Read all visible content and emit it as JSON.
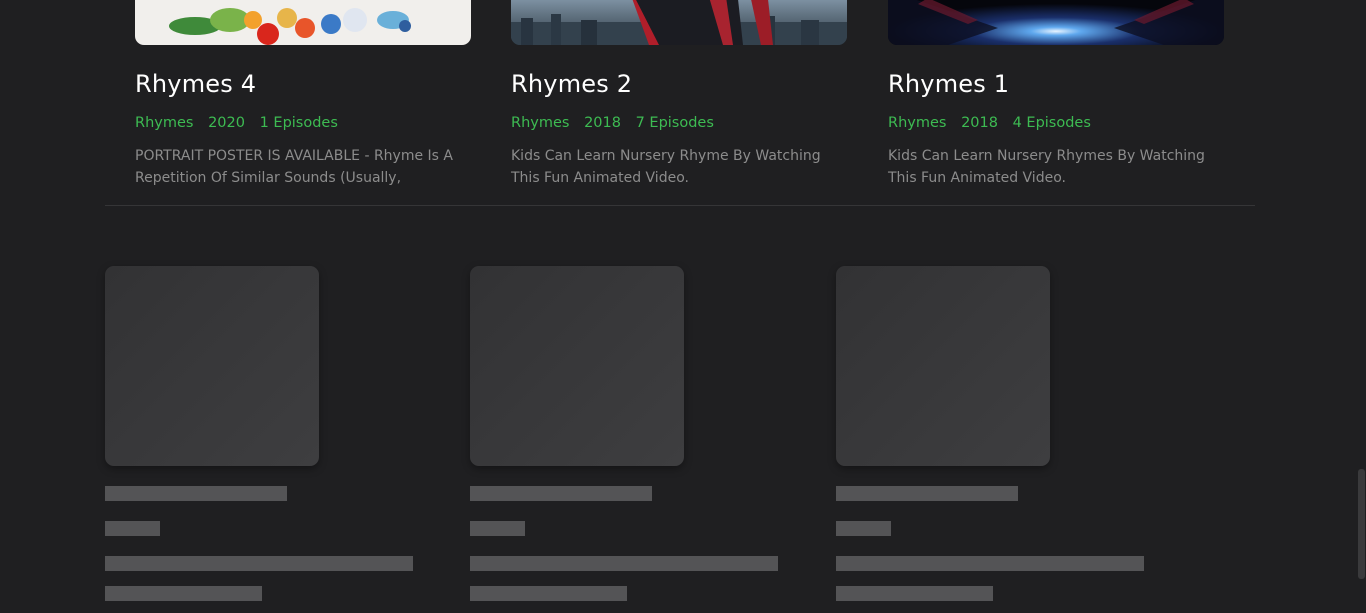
{
  "cards": [
    {
      "title": "Rhymes 4",
      "genre": "Rhymes",
      "year": "2020",
      "episodes": "1 Episodes",
      "description": "PORTRAIT POSTER IS AVAILABLE - Rhyme Is A Repetition Of Similar Sounds (Usually,"
    },
    {
      "title": "Rhymes 2",
      "genre": "Rhymes",
      "year": "2018",
      "episodes": "7 Episodes",
      "description": "Kids Can Learn Nursery Rhyme By Watching This Fun Animated Video."
    },
    {
      "title": "Rhymes 1",
      "genre": "Rhymes",
      "year": "2018",
      "episodes": "4 Episodes",
      "description": "Kids Can Learn Nursery Rhymes By Watching This Fun Animated Video."
    }
  ],
  "colors": {
    "background": "#1f1f21",
    "accent_green": "#3dbb52",
    "description_text": "#8c8c8c",
    "skeleton": "#545456"
  }
}
